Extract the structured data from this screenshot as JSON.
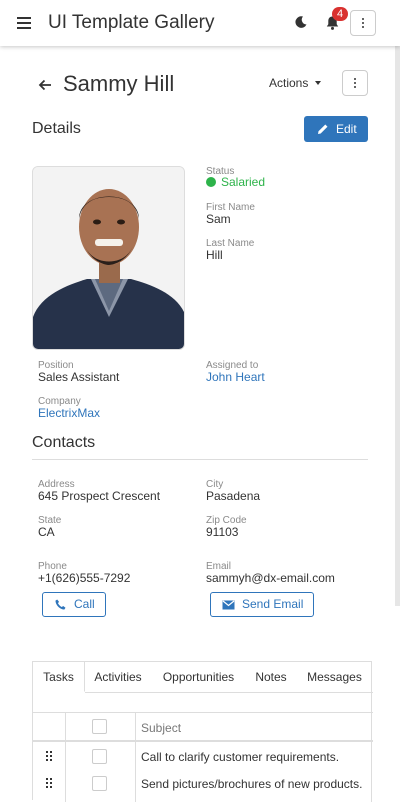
{
  "app": {
    "title": "UI Template Gallery",
    "notifications_count": "4"
  },
  "header": {
    "name": "Sammy Hill",
    "actions_label": "Actions"
  },
  "details": {
    "heading": "Details",
    "edit_label": "Edit",
    "photo_alt": "Sammy Hill photo",
    "status_label": "Status",
    "status_value": "Salaried",
    "first_name_label": "First Name",
    "first_name_value": "Sam",
    "last_name_label": "Last Name",
    "last_name_value": "Hill",
    "position_label": "Position",
    "position_value": "Sales Assistant",
    "assigned_label": "Assigned to",
    "assigned_value": "John Heart",
    "company_label": "Company",
    "company_value": "ElectrixMax"
  },
  "contacts": {
    "heading": "Contacts",
    "address_label": "Address",
    "address_value": "645 Prospect Crescent",
    "city_label": "City",
    "city_value": "Pasadena",
    "state_label": "State",
    "state_value": "CA",
    "zip_label": "Zip Code",
    "zip_value": "91103",
    "phone_label": "Phone",
    "phone_value": "+1(626)555-7292",
    "email_label": "Email",
    "email_value": "sammyh@dx-email.com",
    "call_label": "Call",
    "send_email_label": "Send Email"
  },
  "tabs": [
    "Tasks",
    "Activities",
    "Opportunities",
    "Notes",
    "Messages"
  ],
  "tasks": {
    "subject_header": "Subject",
    "rows": [
      "Call to clarify customer requirements.",
      "Send pictures/brochures of new products."
    ]
  },
  "colors": {
    "accent": "#2f75bb",
    "status_green": "#2db34a",
    "badge_red": "#d9312f"
  }
}
